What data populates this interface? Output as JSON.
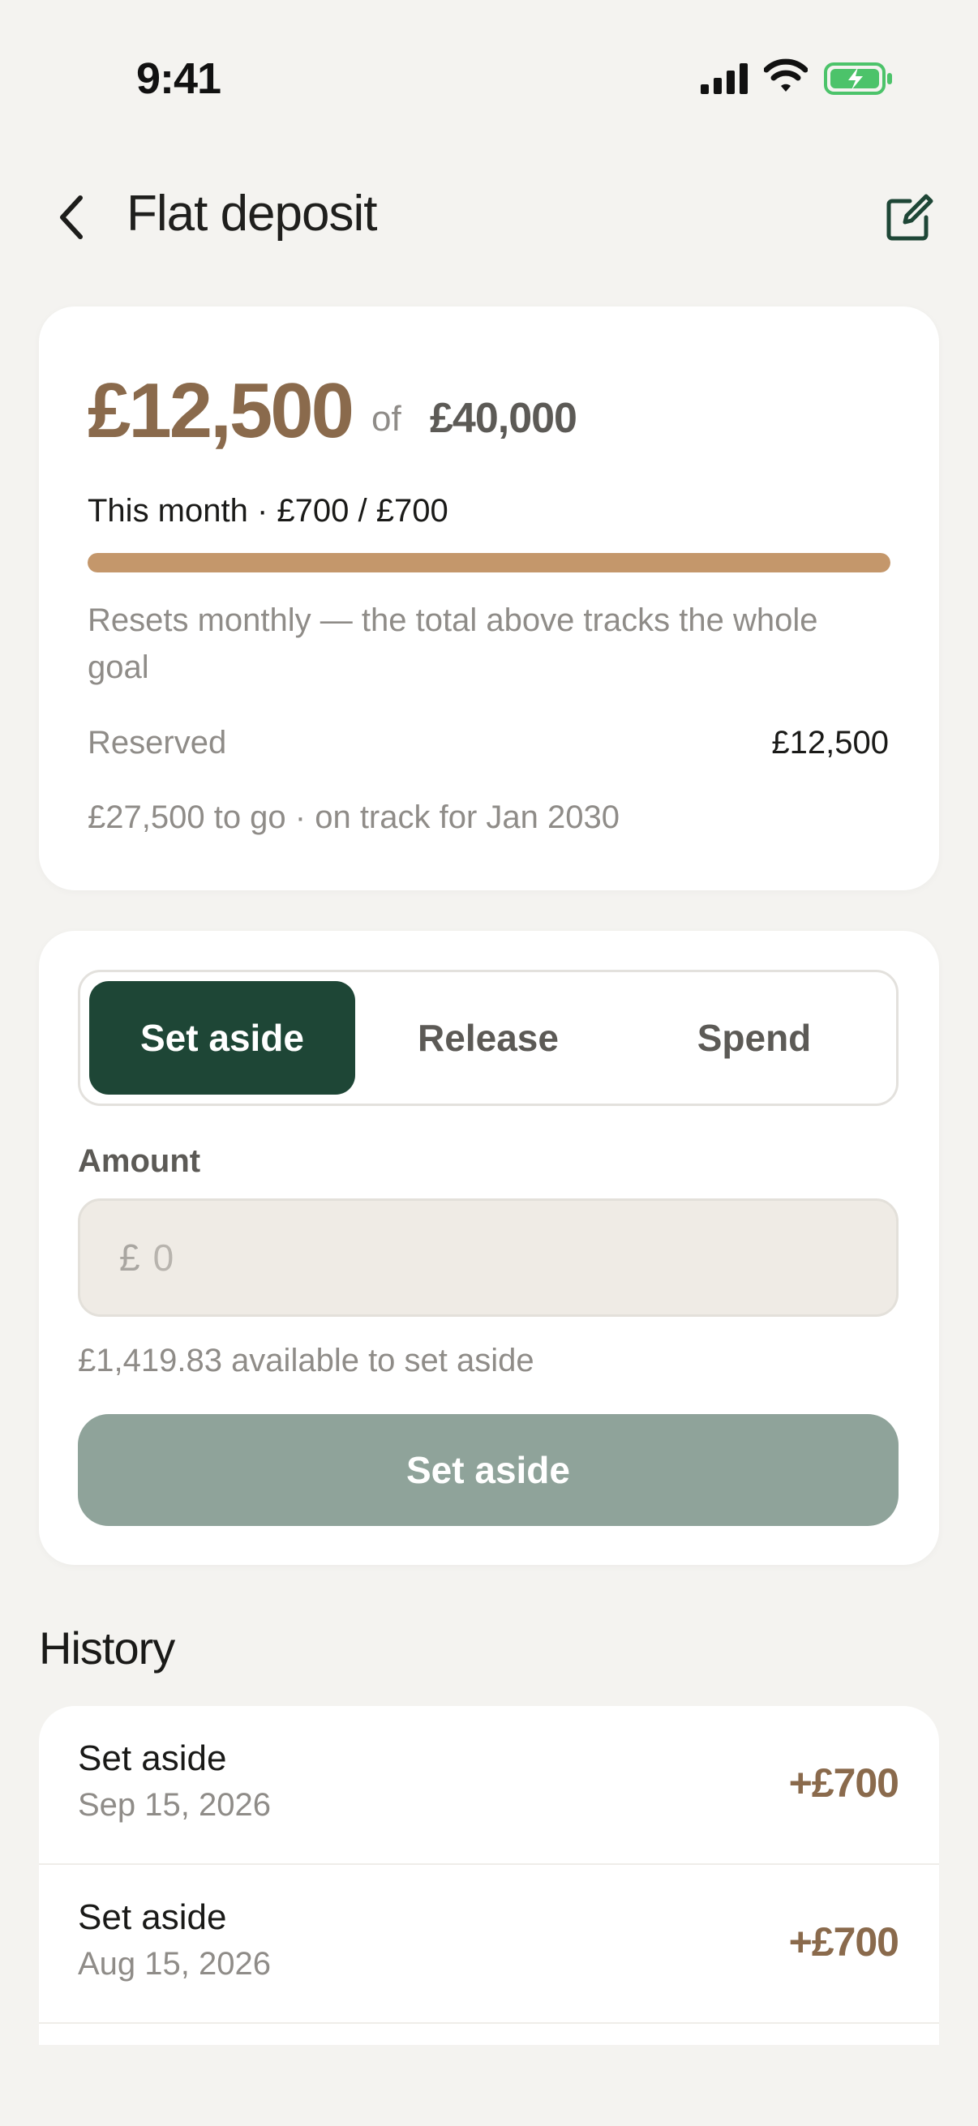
{
  "status_bar": {
    "time": "9:41"
  },
  "header": {
    "title": "Flat deposit"
  },
  "summary": {
    "saved": "£12,500",
    "of_label": "of",
    "target": "£40,000",
    "this_month": "This month · £700 / £700",
    "month_progress": 1.0,
    "note": "Resets monthly — the total above tracks the whole goal",
    "reserved_label": "Reserved",
    "reserved_value": "£12,500",
    "to_go": "£27,500 to go · on track for Jan 2030"
  },
  "action": {
    "segments": [
      "Set aside",
      "Release",
      "Spend"
    ],
    "active_segment": "Set aside",
    "amount_label": "Amount",
    "currency_symbol": "£",
    "amount_placeholder": "0",
    "amount_value": "",
    "available": "£1,419.83 available to set aside",
    "primary_button": "Set aside"
  },
  "history": {
    "title": "History",
    "items": [
      {
        "type": "Set aside",
        "date": "Sep 15, 2026",
        "amount": "+£700"
      },
      {
        "type": "Set aside",
        "date": "Aug 15, 2026",
        "amount": "+£700"
      }
    ]
  },
  "colors": {
    "accent_brown": "#8a6a4c",
    "progress": "#c4976b",
    "active_segment": "#1e4636",
    "disabled_button": "#8fa39a",
    "background": "#f4f3f0"
  },
  "icons": [
    "back-chevron-icon",
    "edit-icon",
    "signal-icon",
    "wifi-icon",
    "battery-charging-icon"
  ]
}
